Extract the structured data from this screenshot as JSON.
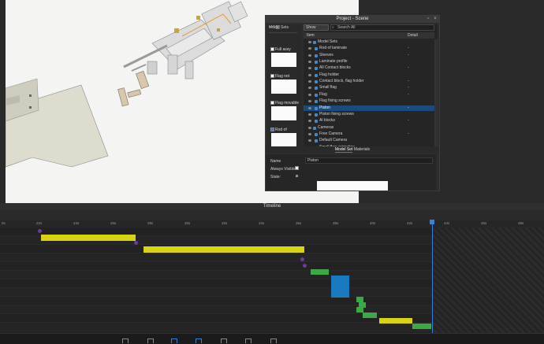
{
  "panel": {
    "title": "Project - Scene",
    "model_sets_header": "Model Sets",
    "show_select": "Show",
    "search_placeholder": "Search All",
    "col_item": "Item",
    "col_detail": "Detail",
    "model_sets": [
      {
        "label": "Full assy",
        "checked": false
      },
      {
        "label": "Flag not",
        "checked": false
      },
      {
        "label": "Flag movable",
        "checked": false
      },
      {
        "label": "Rod of",
        "checked": true
      }
    ],
    "tree": [
      {
        "label": "Model Sets",
        "detail": "",
        "indent": 0
      },
      {
        "label": "Rod of laminate",
        "detail": "-",
        "indent": 1
      },
      {
        "label": "Sleeves",
        "detail": "-",
        "indent": 1
      },
      {
        "label": "Laminate profile",
        "detail": "",
        "indent": 1
      },
      {
        "label": "All Contact blocks",
        "detail": "-",
        "indent": 1
      },
      {
        "label": "Flag holder",
        "detail": "",
        "indent": 1
      },
      {
        "label": "Contact block, flag holder",
        "detail": "-",
        "indent": 1
      },
      {
        "label": "Small flag",
        "detail": "-",
        "indent": 1
      },
      {
        "label": "Flag",
        "detail": "-",
        "indent": 1
      },
      {
        "label": "Flag fixing screws",
        "detail": "",
        "indent": 1
      },
      {
        "label": "Piston",
        "detail": "-",
        "indent": 1,
        "selected": true
      },
      {
        "label": "Piston fixing screws",
        "detail": "",
        "indent": 1
      },
      {
        "label": "Al blocks",
        "detail": "-",
        "indent": 1
      },
      {
        "label": "Cameras",
        "detail": "",
        "indent": 0
      },
      {
        "label": "Free Camera",
        "detail": "-",
        "indent": 1
      },
      {
        "label": "Default Camera",
        "detail": "",
        "indent": 1
      },
      {
        "label": "Small flag animation",
        "detail": "-",
        "indent": 1
      }
    ],
    "tab_model_set": "Model Set",
    "tab_materials": "Materials",
    "prop_name_label": "Name",
    "prop_name_value": "Piston",
    "prop_visible_label": "Always Visible",
    "prop_state_label": "State:"
  },
  "timeline": {
    "title": "Timeline",
    "ticks": [
      "0s",
      "22s",
      "24s",
      "26s",
      "28s",
      "30s",
      "32s",
      "34s",
      "36s",
      "38s",
      "40s",
      "42s",
      "44s",
      "46s",
      "48s"
    ],
    "playhead_time": "43s"
  },
  "colors": {
    "yellow": "#d8d414",
    "green": "#3da845",
    "blue": "#1a7ac0",
    "purple": "#6a3aa0",
    "playhead": "#3d7fd6"
  }
}
